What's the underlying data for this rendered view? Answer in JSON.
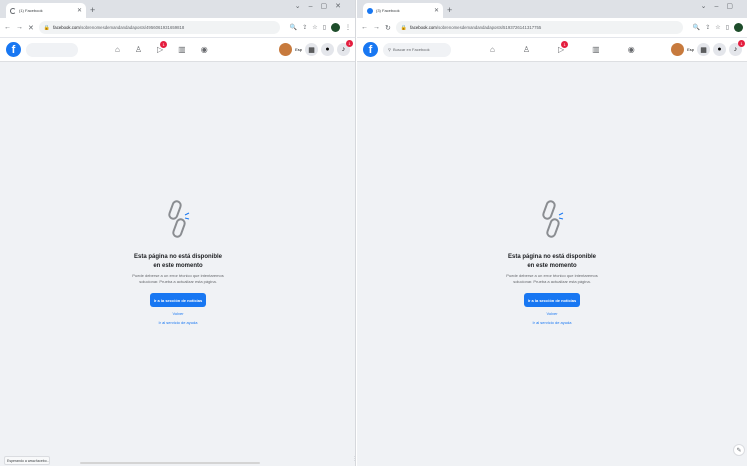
{
  "left": {
    "tab_title": "(1) Facebook",
    "url_domain": "facebook.com",
    "url_path": "/sobrenomesdemandandadaposts/4956061931659818",
    "search_placeholder": "",
    "status_text": "Esperando a www.facebo..."
  },
  "right": {
    "tab_title": "(3) Facebook",
    "url_domain": "facebook.com",
    "url_path": "/sobrenomesdemandandadaposts/5193726141317755",
    "search_placeholder": "Buscar en Facebook"
  },
  "shared": {
    "nf_title": "Esta página no está disponible en este momento",
    "nf_desc": "Puede deberse a un error técnico que intentaremos solucionar. Prueba a actualizar esta página.",
    "nf_button": "Ir a la sección de noticias",
    "nf_back": "Volver",
    "nf_help": "Ir al servicio de ayuda",
    "notif_badge": "1",
    "profile_name": "Esp"
  },
  "colors": {
    "brand": "#1877f2",
    "badge": "#e41e3f",
    "page_bg": "#f0f2f5"
  }
}
